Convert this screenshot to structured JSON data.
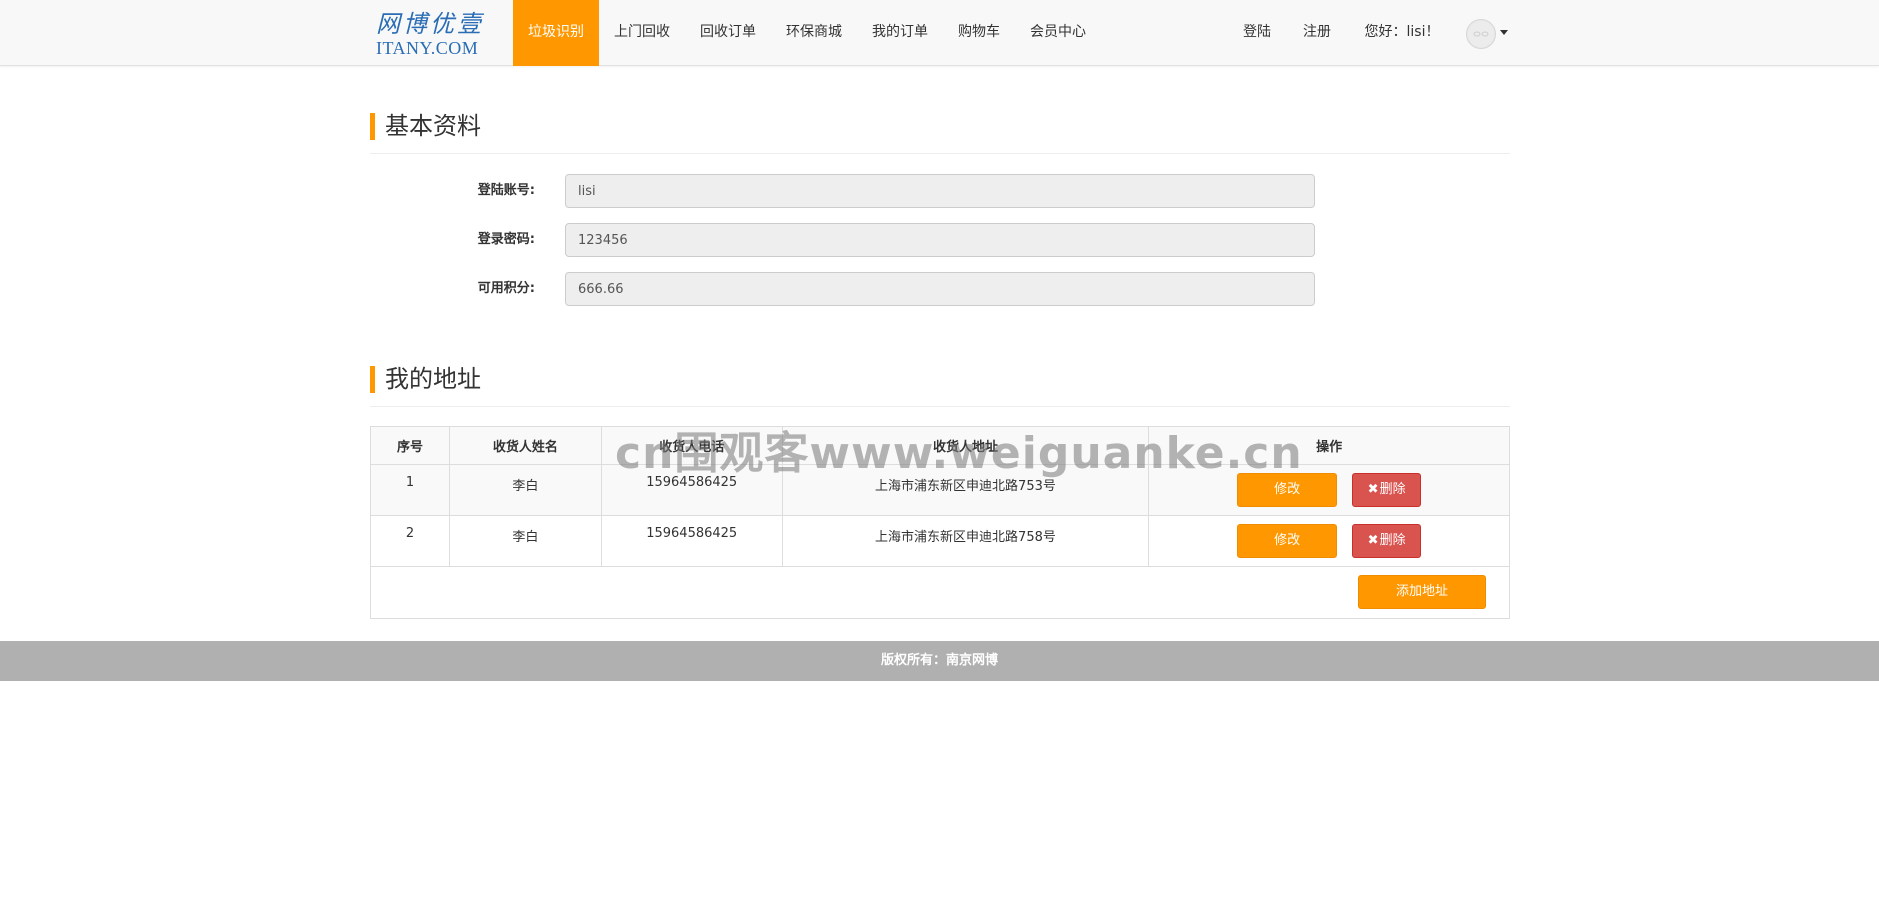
{
  "brand": {
    "name_cn": "网博优壹",
    "name_en": "ITANY.COM",
    "color": "#2a6db5"
  },
  "accent_color": "#ff9800",
  "nav": {
    "items": [
      {
        "label": "垃圾识别",
        "active": true
      },
      {
        "label": "上门回收"
      },
      {
        "label": "回收订单"
      },
      {
        "label": "环保商城"
      },
      {
        "label": "我的订单"
      },
      {
        "label": "购物车"
      },
      {
        "label": "会员中心"
      }
    ],
    "right": {
      "login": "登陆",
      "register": "注册",
      "greeting": "您好：lisi！"
    },
    "avatar_icon": "user-avatar-icon",
    "dropdown_icon": "caret-down-icon"
  },
  "profile": {
    "title": "基本资料",
    "fields": [
      {
        "label": "登陆账号:",
        "value": "lisi"
      },
      {
        "label": "登录密码:",
        "value": "123456"
      },
      {
        "label": "可用积分:",
        "value": "666.66"
      }
    ]
  },
  "address": {
    "title": "我的地址",
    "columns": [
      "序号",
      "收货人姓名",
      "收货人电话",
      "收货人地址",
      "操作"
    ],
    "rows": [
      {
        "index": "1",
        "name": "李白",
        "phone": "15964586425",
        "addr": "上海市浦东新区申迪北路753号"
      },
      {
        "index": "2",
        "name": "李白",
        "phone": "15964586425",
        "addr": "上海市浦东新区申迪北路758号"
      }
    ],
    "edit_label": "修改",
    "delete_icon": "✖",
    "delete_label": "删除",
    "add_label": "添加地址"
  },
  "watermark": "cn围观客www.weiguanke.cn",
  "footer": {
    "copyright": "版权所有：南京网博"
  }
}
